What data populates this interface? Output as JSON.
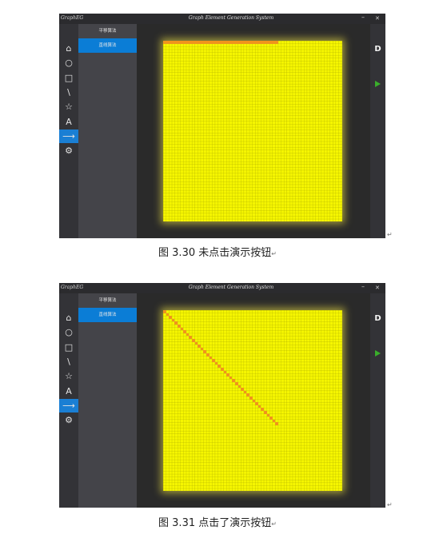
{
  "window": {
    "logo": "GraphEG",
    "title": "Graph Element Generation System",
    "minimize": "–",
    "close": "✕"
  },
  "sidebar_icons": [
    {
      "name": "home-icon",
      "glyph": "⌂"
    },
    {
      "name": "circle-icon",
      "glyph": "○"
    },
    {
      "name": "square-icon",
      "glyph": "□"
    },
    {
      "name": "line-icon",
      "glyph": "\\"
    },
    {
      "name": "star-icon",
      "glyph": "☆"
    },
    {
      "name": "text-icon",
      "glyph": "A"
    },
    {
      "name": "arrow-icon",
      "glyph": "⟶",
      "active": true
    },
    {
      "name": "gear-icon",
      "glyph": "⚙"
    }
  ],
  "algorithms": [
    "平移算法",
    "直线算法"
  ],
  "selected_algorithm": 1,
  "right_panel": {
    "mode_label": "D"
  },
  "colors": {
    "grid": "#f6f600",
    "pixel": "#f0941c",
    "accent": "#0b7dd6",
    "play": "#3aae2b"
  },
  "screens": [
    {
      "state": "not clicked",
      "highlight": "top-row",
      "cells": 40
    },
    {
      "state": "clicked",
      "highlight": "diagonal",
      "cells": 40
    }
  ],
  "captions": [
    "图 3.30  未点击演示按钮",
    "图 3.31  点击了演示按钮"
  ],
  "return_mark": "↵"
}
